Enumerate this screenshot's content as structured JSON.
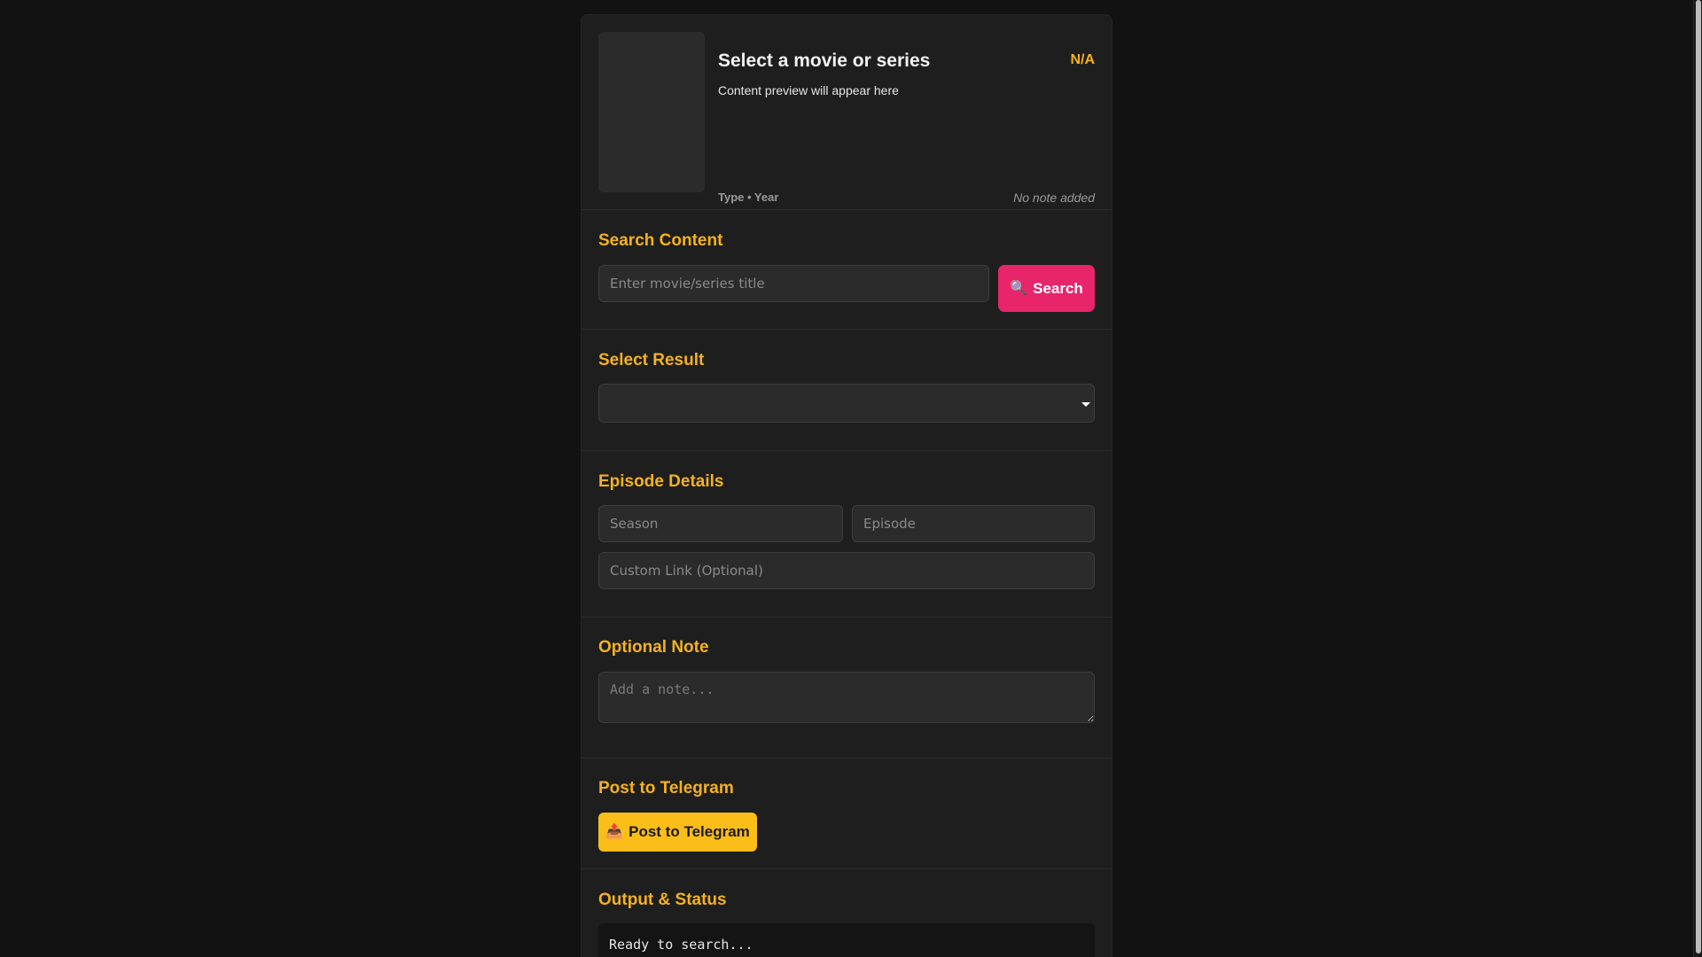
{
  "preview": {
    "title": "Select a movie or series",
    "rating": "N/A",
    "description": "Content preview will appear here",
    "meta": "Type • Year",
    "note": "No note added"
  },
  "search": {
    "heading": "Search Content",
    "placeholder": "Enter movie/series title",
    "button_icon": "🔍",
    "button_label": "Search"
  },
  "select_result": {
    "heading": "Select Result",
    "selected": ""
  },
  "episode": {
    "heading": "Episode Details",
    "season_placeholder": "Season",
    "episode_placeholder": "Episode",
    "link_placeholder": "Custom Link (Optional)"
  },
  "note": {
    "heading": "Optional Note",
    "placeholder": "Add a note..."
  },
  "telegram": {
    "heading": "Post to Telegram",
    "button_icon": "📤",
    "button_label": "Post to Telegram"
  },
  "output": {
    "heading": "Output & Status",
    "text": "Ready to search..."
  },
  "colors": {
    "accent": "#f5b21b",
    "search_button": "#e8256b",
    "post_button": "#fbbd17",
    "background": "#121212",
    "panel": "#1e1e1e"
  }
}
